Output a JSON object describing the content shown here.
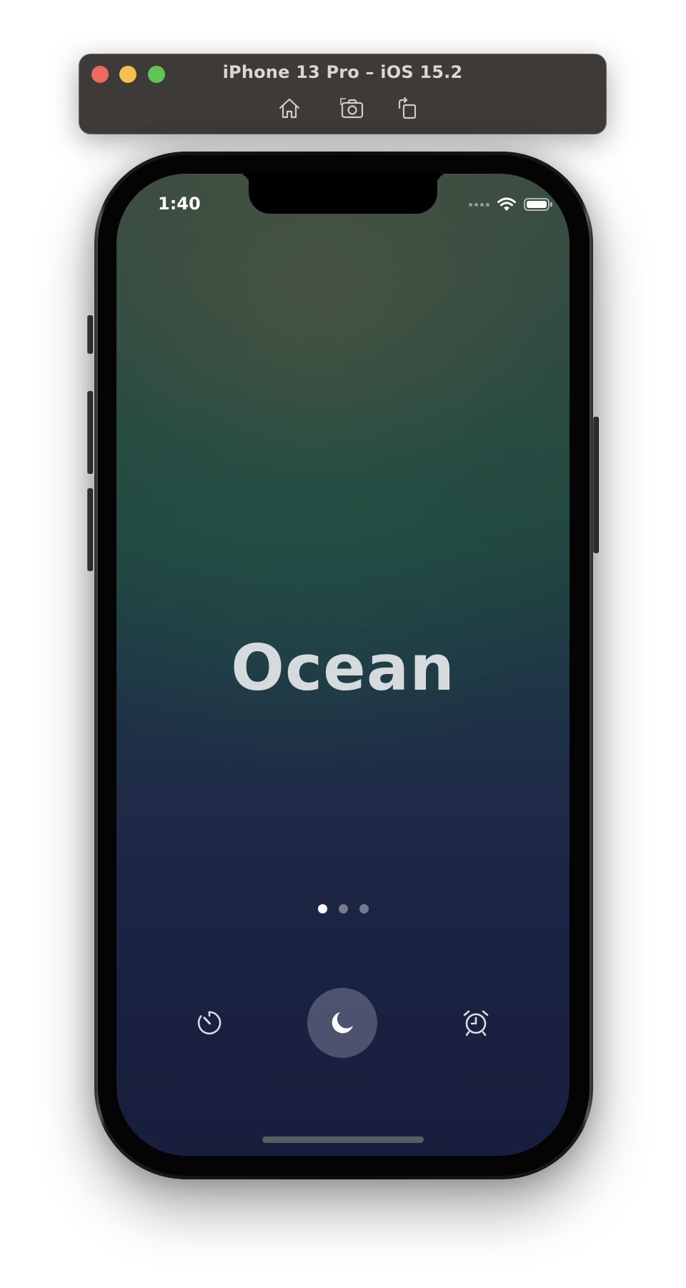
{
  "simulator": {
    "title": "iPhone 13 Pro – iOS 15.2",
    "toolbar": {
      "home_icon": "home-icon",
      "screenshot_icon": "camera-icon",
      "rotate_icon": "rotate-icon"
    },
    "window_buttons": [
      "close",
      "minimize",
      "zoom"
    ]
  },
  "status_bar": {
    "time": "1:40",
    "icons": [
      "cellular-signal-icon",
      "wifi-icon",
      "battery-icon"
    ]
  },
  "main": {
    "sound_title": "Ocean",
    "page_indicator": {
      "count": 3,
      "active_index": 0
    }
  },
  "bottom_bar": {
    "items": [
      {
        "icon": "timer-icon"
      },
      {
        "icon": "moon-icon",
        "selected": true
      },
      {
        "icon": "alarm-clock-icon"
      }
    ]
  },
  "colors": {
    "sim_bar": "#3d3a38",
    "close": "#ed6a5e",
    "minimize": "#f5bf4f",
    "zoom": "#61c554",
    "background_top": "#3c4d41",
    "background_mid": "#22483f",
    "background_bottom": "#181e3c",
    "title_text": "#d5dadc"
  }
}
